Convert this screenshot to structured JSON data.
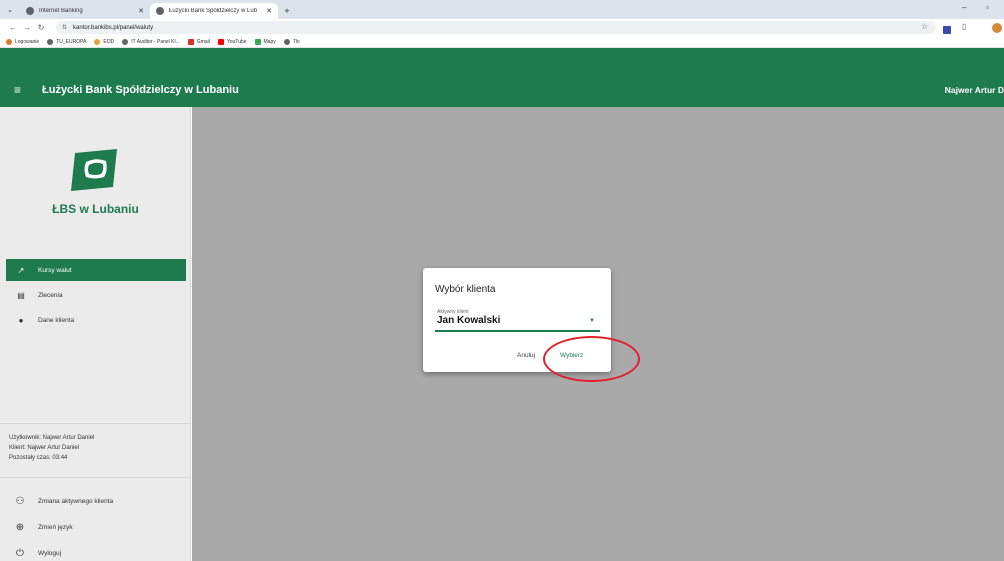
{
  "browser": {
    "tabs": [
      {
        "title": "Internet Banking",
        "active": false
      },
      {
        "title": "Łużycki Bank Spółdzielczy w Lub",
        "active": true
      }
    ],
    "new_tab": "+",
    "url": "kantor.bankibs.pl/panel/waluty",
    "bookmarks": [
      "Logowanie",
      "TU_EUROPA",
      "EOD",
      "IT Auditor - Panel Kl...",
      "Gmail",
      "YouTube",
      "Mapy",
      "Tlo"
    ]
  },
  "header": {
    "title": "Łużycki Bank Spółdzielczy w Lubaniu",
    "user": "Najwer Artur D"
  },
  "sidebar": {
    "logo_text": "ŁBS w Lubaniu",
    "menu": [
      {
        "label": "Kursy walut",
        "icon": "trending-up-icon",
        "active": true
      },
      {
        "label": "Zlecenia",
        "icon": "document-icon",
        "active": false
      },
      {
        "label": "Dane klienta",
        "icon": "person-icon",
        "active": false
      }
    ],
    "user_info": {
      "user": "Użytkownik: Najwer Artur Daniel",
      "client": "Klient: Najwer Artur Daniel",
      "time": "Pozostały czas: 03:44"
    },
    "bottom": [
      {
        "label": "Zmiana aktywnego klienta",
        "icon": "person-switch-icon"
      },
      {
        "label": "Zmień język",
        "icon": "globe-icon"
      },
      {
        "label": "Wyloguj",
        "icon": "power-icon"
      }
    ]
  },
  "dialog": {
    "title": "Wybór klienta",
    "select_label": "Aktywny klient",
    "select_value": "Jan Kowalski",
    "cancel": "Anuluj",
    "confirm": "Wybierz"
  },
  "colors": {
    "brand": "#1e7b4e",
    "annotation": "#e0212a"
  }
}
